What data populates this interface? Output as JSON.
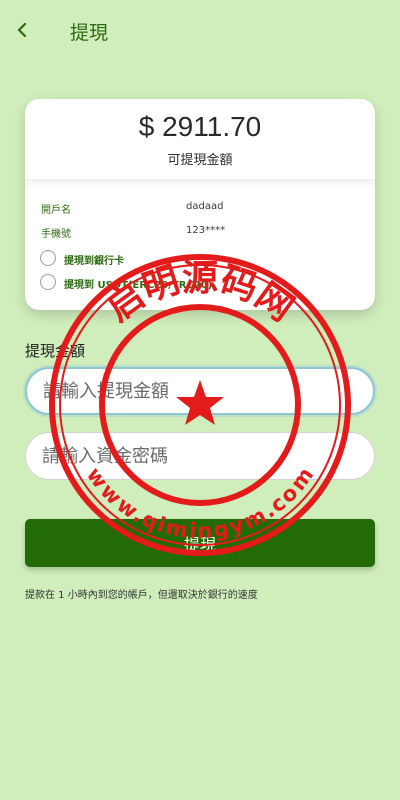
{
  "header": {
    "back_icon": "chevron-left-icon",
    "title": "提現"
  },
  "balance": {
    "amount": "$ 2911.70",
    "label": "可提現金額"
  },
  "account_info": [
    {
      "label": "開戶名",
      "value": "dadaad"
    },
    {
      "label": "手機號",
      "value": "123****"
    }
  ],
  "withdraw_options": [
    {
      "label": "提現到銀行卡",
      "selected": false
    },
    {
      "label": "提現到 USDT(ERC20/TRC20)",
      "selected": false
    }
  ],
  "form": {
    "amount_section_label": "提現金額",
    "amount_placeholder": "請輸入提現金額",
    "password_placeholder": "請輸入資金密碼",
    "submit_label": "提現"
  },
  "notice": "提款在 1 小時內到您的帳戶，但還取決於銀行的速度",
  "watermark": {
    "text_top": "启明源码网",
    "text_bottom": "www.qimingym.com"
  },
  "colors": {
    "background": "#cfeebb",
    "accent": "#226b06",
    "stamp": "#e41b1b"
  }
}
